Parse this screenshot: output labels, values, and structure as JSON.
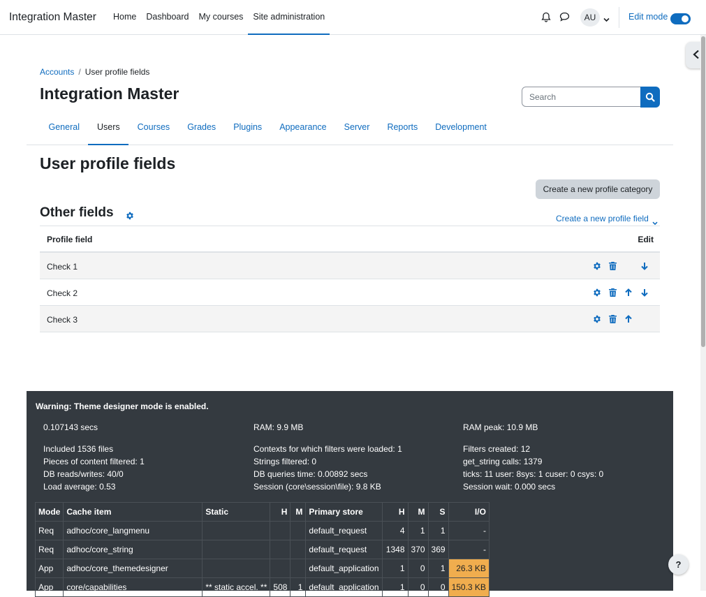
{
  "navbar": {
    "brand": "Integration Master",
    "links": [
      {
        "label": "Home"
      },
      {
        "label": "Dashboard"
      },
      {
        "label": "My courses"
      },
      {
        "label": "Site administration"
      }
    ],
    "avatar_initials": "AU",
    "edit_mode_label": "Edit mode",
    "edit_mode_on": true
  },
  "breadcrumb": {
    "parent": "Accounts",
    "separator": "/",
    "current": "User profile fields"
  },
  "header": {
    "site_title": "Integration Master",
    "search_placeholder": "Search"
  },
  "admin_tabs": [
    {
      "label": "General"
    },
    {
      "label": "Users"
    },
    {
      "label": "Courses"
    },
    {
      "label": "Grades"
    },
    {
      "label": "Plugins"
    },
    {
      "label": "Appearance"
    },
    {
      "label": "Server"
    },
    {
      "label": "Reports"
    },
    {
      "label": "Development"
    }
  ],
  "main": {
    "page_heading": "User profile fields",
    "create_category_label": "Create a new profile category",
    "section_heading": "Other fields",
    "create_field_label": "Create a new profile field",
    "table": {
      "col_field": "Profile field",
      "col_edit": "Edit",
      "rows": [
        {
          "name": "Check 1"
        },
        {
          "name": "Check 2"
        },
        {
          "name": "Check 3"
        }
      ]
    }
  },
  "perf": {
    "warning": "Warning: Theme designer mode is enabled.",
    "time": "0.107143 secs",
    "ram": "RAM: 9.9 MB",
    "ram_peak": "RAM peak: 10.9 MB",
    "col1": [
      "Included 1536 files",
      "Pieces of content filtered: 1",
      "DB reads/writes: 40/0",
      "Load average: 0.53"
    ],
    "col2": [
      "Contexts for which filters were loaded: 1",
      "Strings filtered: 0",
      "DB queries time: 0.00892 secs",
      "Session (core\\session\\file): 9.8 KB"
    ],
    "col3": [
      "Filters created: 12",
      "get_string calls: 1379",
      "ticks: 11 user: 8sys: 1 cuser: 0 csys: 0",
      "Session wait: 0.000 secs"
    ],
    "cache_headers": [
      "Mode",
      "Cache item",
      "Static",
      "H",
      "M",
      "Primary store",
      "H",
      "M",
      "S",
      "I/O"
    ],
    "cache_rows": [
      [
        "Req",
        "adhoc/core_langmenu",
        "",
        "",
        "",
        "default_request",
        "4",
        "1",
        "1",
        "-"
      ],
      [
        "Req",
        "adhoc/core_string",
        "",
        "",
        "",
        "default_request",
        "1348",
        "370",
        "369",
        "-"
      ],
      [
        "App",
        "adhoc/core_themedesigner",
        "",
        "",
        "",
        "default_application",
        "1",
        "0",
        "1",
        "26.3 KB"
      ],
      [
        "App",
        "core/capabilities",
        "** static accel. **",
        "508",
        "1",
        "default_application",
        "1",
        "0",
        "0",
        "150.3 KB"
      ]
    ]
  },
  "help_label": "?",
  "colors": {
    "primary": "#0f6cbf",
    "footer_bg": "#343a40",
    "io_highlight": "#f0ad4e"
  }
}
